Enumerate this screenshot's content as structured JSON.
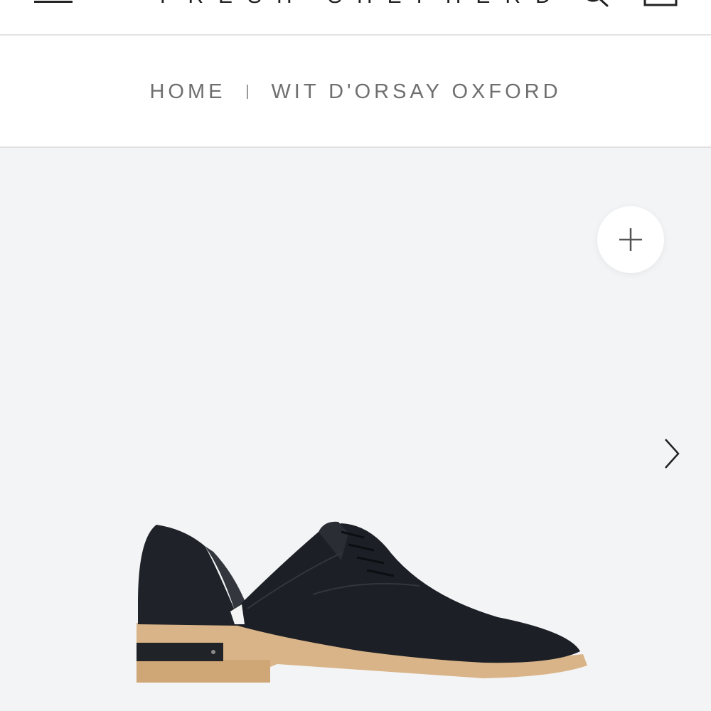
{
  "header": {
    "logo_text": "FRESH SHEPHERD",
    "menu_icon": "hamburger-menu-icon",
    "search_icon": "search-icon",
    "cart_icon": "cart-bag-icon"
  },
  "breadcrumb": {
    "items": [
      {
        "label": "HOME"
      },
      {
        "label": "WIT D'ORSAY OXFORD"
      }
    ]
  },
  "gallery": {
    "zoom_icon": "plus-icon",
    "next_icon": "chevron-right-icon",
    "product_image": "black-nubuck-dorsay-oxford-shoe-with-wood-heel",
    "background_color": "#f3f4f6"
  }
}
